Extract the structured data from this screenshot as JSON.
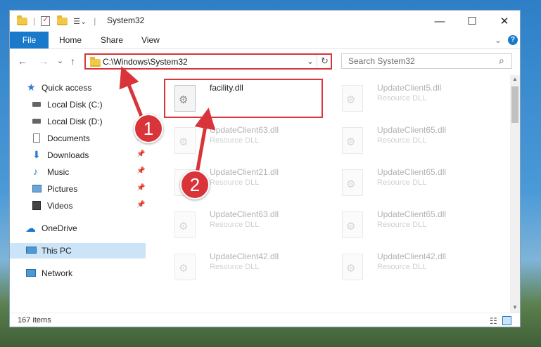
{
  "window": {
    "title": "System32",
    "minimize_glyph": "—",
    "maximize_glyph": "☐",
    "close_glyph": "✕"
  },
  "ribbon": {
    "file_tab": "File",
    "tabs": [
      "Home",
      "Share",
      "View"
    ],
    "expand_glyph": "⌄",
    "help_glyph": "?"
  },
  "nav": {
    "back_glyph": "←",
    "forward_glyph": "→",
    "recent_glyph": "⌄",
    "up_glyph": "↑",
    "address": "C:\\Windows\\System32",
    "address_dropdown_glyph": "⌄",
    "refresh_glyph": "↻",
    "search_placeholder": "Search System32",
    "search_glyph": "⌕"
  },
  "sidebar": {
    "items": [
      {
        "label": "Quick access",
        "icon": "star-icon",
        "pinned": false
      },
      {
        "label": "Local Disk (C:)",
        "icon": "drive-icon",
        "pinned": false
      },
      {
        "label": "Local Disk (D:)",
        "icon": "drive-icon",
        "pinned": false
      },
      {
        "label": "Documents",
        "icon": "documents-icon",
        "pinned": true
      },
      {
        "label": "Downloads",
        "icon": "downloads-icon",
        "pinned": true
      },
      {
        "label": "Music",
        "icon": "music-icon",
        "pinned": true
      },
      {
        "label": "Pictures",
        "icon": "pictures-icon",
        "pinned": true
      },
      {
        "label": "Videos",
        "icon": "videos-icon",
        "pinned": true
      },
      {
        "label": "OneDrive",
        "icon": "onedrive-icon",
        "pinned": false
      },
      {
        "label": "This PC",
        "icon": "pc-icon",
        "pinned": false,
        "selected": true
      },
      {
        "label": "Network",
        "icon": "network-icon",
        "pinned": false
      }
    ],
    "pin_glyph": "📌"
  },
  "files": [
    {
      "name": "facility.dll",
      "type": "",
      "highlighted": true
    },
    {
      "name": "UpdateClient5.dll",
      "type": "Resource DLL"
    },
    {
      "name": "UpdateClient63.dll",
      "type": "Resource DLL"
    },
    {
      "name": "UpdateClient65.dll",
      "type": "Resource DLL"
    },
    {
      "name": "UpdateClient21.dll",
      "type": "Resource DLL"
    },
    {
      "name": "UpdateClient65.dll",
      "type": "Resource DLL"
    },
    {
      "name": "UpdateClient63.dll",
      "type": "Resource DLL"
    },
    {
      "name": "UpdateClient65.dll",
      "type": "Resource DLL"
    },
    {
      "name": "UpdateClient42.dll",
      "type": "Resource DLL"
    },
    {
      "name": "UpdateClient42.dll",
      "type": "Resource DLL"
    }
  ],
  "status": {
    "item_count": "167 items"
  },
  "annotations": {
    "step1": "1",
    "step2": "2",
    "accent_color": "#d9343a"
  }
}
